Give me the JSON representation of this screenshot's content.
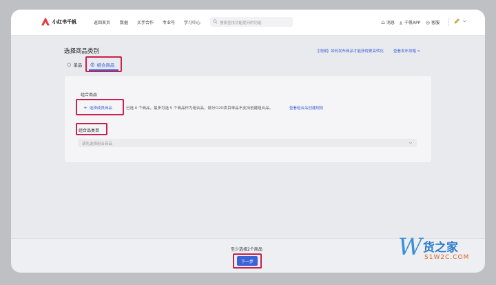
{
  "nav": {
    "brand": "小红书千帆",
    "items": [
      "返回首页",
      "数据",
      "买手合作",
      "专业号",
      "学习中心"
    ],
    "search_placeholder": "搜索查找功能提问的功能",
    "right": {
      "messages": "消息",
      "app": "千帆APP",
      "service": "客服"
    }
  },
  "page": {
    "title": "选择商品类别",
    "help_video": "【视频】如何发布商品才能获得更高转化",
    "help_guide": "查看发布攻略 >"
  },
  "tabs": [
    {
      "label": "单品",
      "active": false
    },
    {
      "label": "组合商品",
      "active": true
    }
  ],
  "combo": {
    "section_label": "组合商品",
    "add_button": "选择成员商品",
    "rule_text": "已选 0 个商品，最多可选 5 个商品作为组合品，部分O2O类目单品不支持创建组合品。",
    "rule_link": "查看组合品创建规则",
    "category_label": "组合品类目",
    "category_placeholder": "请先选择组合商品"
  },
  "footer": {
    "hint": "至少选择2个商品",
    "next_button": "下一步"
  },
  "watermark": {
    "cn": "货之家",
    "en": "S1W2C.COM"
  },
  "colors": {
    "accent": "#3a63d8",
    "highlight": "#c8204f",
    "brand_red": "#e8383d"
  }
}
